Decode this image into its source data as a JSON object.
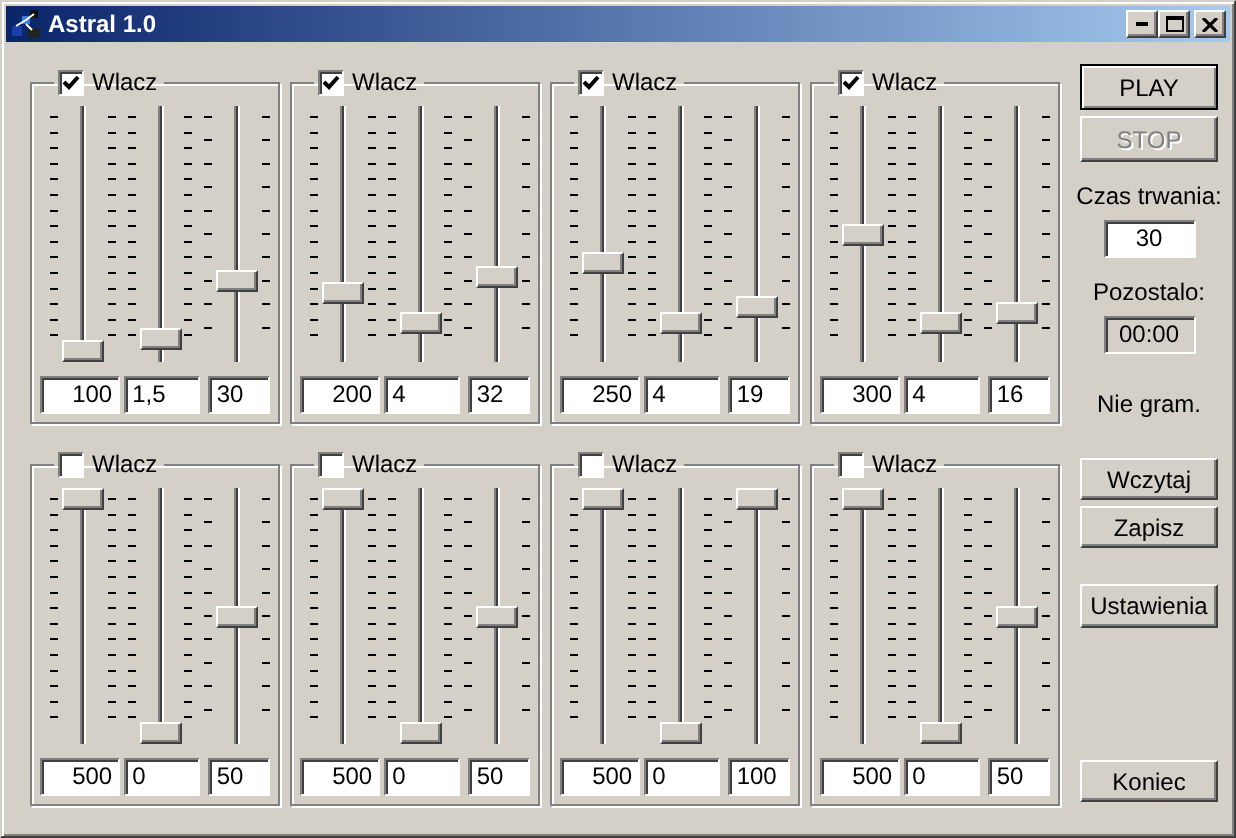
{
  "window": {
    "title": "Astral 1.0"
  },
  "channels": [
    {
      "label": "Wlacz",
      "enabled": true,
      "sliders": [
        {
          "level": 0
        },
        {
          "level": 0.05
        },
        {
          "level": 0.3
        }
      ],
      "fields": [
        "100",
        "1,5",
        "30"
      ]
    },
    {
      "label": "Wlacz",
      "enabled": true,
      "sliders": [
        {
          "level": 0.25
        },
        {
          "level": 0.12
        },
        {
          "level": 0.32
        }
      ],
      "fields": [
        "200",
        "4",
        "32"
      ]
    },
    {
      "label": "Wlacz",
      "enabled": true,
      "sliders": [
        {
          "level": 0.375
        },
        {
          "level": 0.12
        },
        {
          "level": 0.19
        }
      ],
      "fields": [
        "250",
        "4",
        "19"
      ]
    },
    {
      "label": "Wlacz",
      "enabled": true,
      "sliders": [
        {
          "level": 0.5
        },
        {
          "level": 0.12
        },
        {
          "level": 0.16
        }
      ],
      "fields": [
        "300",
        "4",
        "16"
      ]
    },
    {
      "label": "Wlacz",
      "enabled": false,
      "sliders": [
        {
          "level": 1
        },
        {
          "level": 0
        },
        {
          "level": 0.5
        }
      ],
      "fields": [
        "500",
        "0",
        "50"
      ]
    },
    {
      "label": "Wlacz",
      "enabled": false,
      "sliders": [
        {
          "level": 1
        },
        {
          "level": 0
        },
        {
          "level": 0.5
        }
      ],
      "fields": [
        "500",
        "0",
        "50"
      ]
    },
    {
      "label": "Wlacz",
      "enabled": false,
      "sliders": [
        {
          "level": 1
        },
        {
          "level": 0
        },
        {
          "level": 1
        }
      ],
      "fields": [
        "500",
        "0",
        "100"
      ]
    },
    {
      "label": "Wlacz",
      "enabled": false,
      "sliders": [
        {
          "level": 1
        },
        {
          "level": 0
        },
        {
          "level": 0.5
        }
      ],
      "fields": [
        "500",
        "0",
        "50"
      ]
    }
  ],
  "playback": [
    {
      "label": "PLAY",
      "default": true,
      "disabled": false
    },
    {
      "label": "STOP",
      "default": false,
      "disabled": true
    }
  ],
  "duration": {
    "label": "Czas trwania:",
    "value": "30"
  },
  "remaining": {
    "label": "Pozostalo:",
    "value": "00:00"
  },
  "status": "Nie gram.",
  "file_buttons": [
    "Wczytaj",
    "Zapisz"
  ],
  "settings_button": "Ustawienia",
  "exit_button": "Koniec"
}
